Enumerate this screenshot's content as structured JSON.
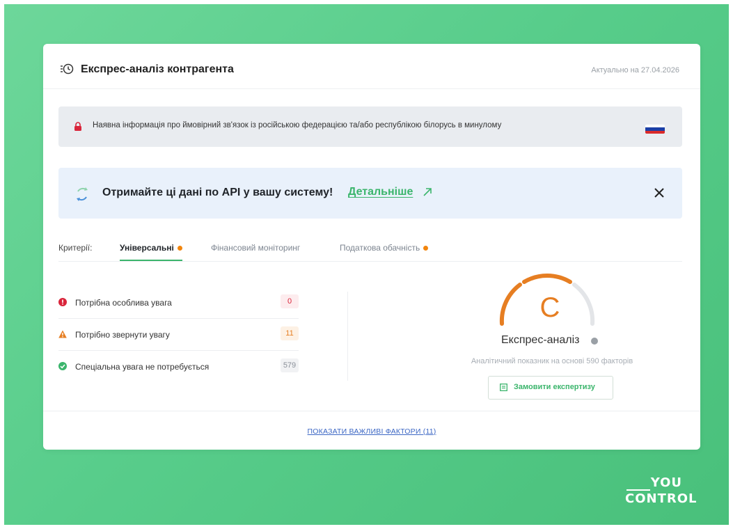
{
  "header": {
    "title": "Експрес-аналіз контрагента",
    "date": "Актуально на 27.04.2026"
  },
  "sanction": {
    "text": "Наявна інформація про ймовірний зв'язок із російською федерацією та/або республікою білорусь в минулому",
    "flag_colors": [
      "#ffffff",
      "#1b3fa6",
      "#d92b2b"
    ]
  },
  "api_banner": {
    "text": "Отримайте ці дані по API у вашу систему!",
    "link": "Детальніше",
    "close_icon": "close-icon"
  },
  "tabs": {
    "label": "Критерії:",
    "items": [
      {
        "label": "Універсальні",
        "active": true,
        "dot": true
      },
      {
        "label": "Фінансовий моніторинг",
        "active": false,
        "dot": false
      },
      {
        "label": "Податкова обачність",
        "active": false,
        "dot": true
      }
    ]
  },
  "criteria": [
    {
      "label": "Потрібна особлива увага",
      "count": "0",
      "icon": "exclamation-circle-icon",
      "color": "#d9253b",
      "bg": "#fdecee"
    },
    {
      "label": "Потрібно звернути увагу",
      "count": "11",
      "icon": "warning-triangle-icon",
      "color": "#e67e22",
      "bg": "#fdf1e4"
    },
    {
      "label": "Спеціальна увага не потребується",
      "count": "579",
      "icon": "check-circle-icon",
      "color": "#3bb56c",
      "bg": "#f1f2f4"
    }
  ],
  "analysis": {
    "grade": "C",
    "grade_color": "#e67e22",
    "title": "Експрес-аналіз",
    "subtitle": "Аналітичний показник на основі 590 факторів",
    "order_button": "Замовити експертизу"
  },
  "footer": {
    "link": "ПОКАЗАТИ ВАЖЛИВІ ФАКТОРИ (11)"
  },
  "logo": {
    "top": "YOU",
    "bottom": "CONTROL"
  }
}
